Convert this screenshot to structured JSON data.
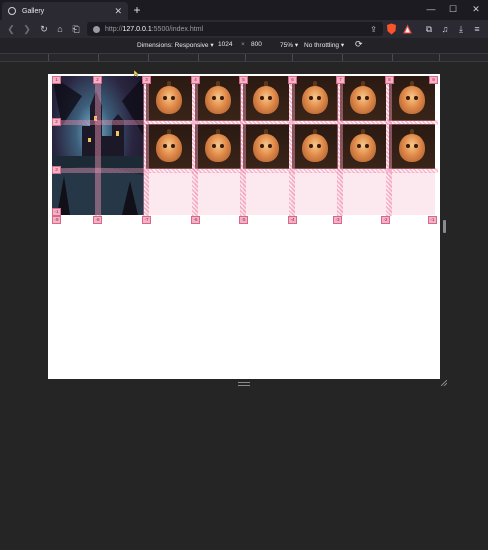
{
  "tab": {
    "title": "Gallery",
    "close": "✕",
    "favicon": "globe-icon"
  },
  "newtab_label": "+",
  "window": {
    "minimize": "—",
    "maximize": "☐",
    "close": "✕"
  },
  "nav": {
    "back": "❮",
    "forward": "❯",
    "reload": "↻",
    "home": "⌂",
    "bookmark": "⎗",
    "url_prefix": "http://",
    "url_host": "127.0.0.1",
    "url_rest": ":5500/index.html",
    "share": "⇪",
    "extensions": "⧉",
    "music": "♫",
    "download": "⤓",
    "menu": "≡"
  },
  "rdm": {
    "dimensions_label": "Dimensions: Responsive ▾",
    "width": "1024",
    "times": "×",
    "height": "800",
    "zoom": "75% ▾",
    "throttling": "No throttling ▾",
    "rotate": "⟳"
  },
  "gallery": {
    "feature_image": "haunted-castle-painting",
    "tile_image": "jack-o-lantern-pumpkin",
    "accent": "#e678a0",
    "overlay_bg": "#fbe9ef"
  },
  "grid_badges": {
    "top": [
      "1",
      "2",
      "3",
      "4",
      "5",
      "6",
      "7",
      "8",
      "9"
    ],
    "left": [
      "2",
      "3"
    ],
    "bottom": [
      "-1",
      "-9",
      "-8",
      "-7",
      "-6",
      "-5",
      "-4",
      "-3",
      "-2",
      "-1"
    ]
  }
}
